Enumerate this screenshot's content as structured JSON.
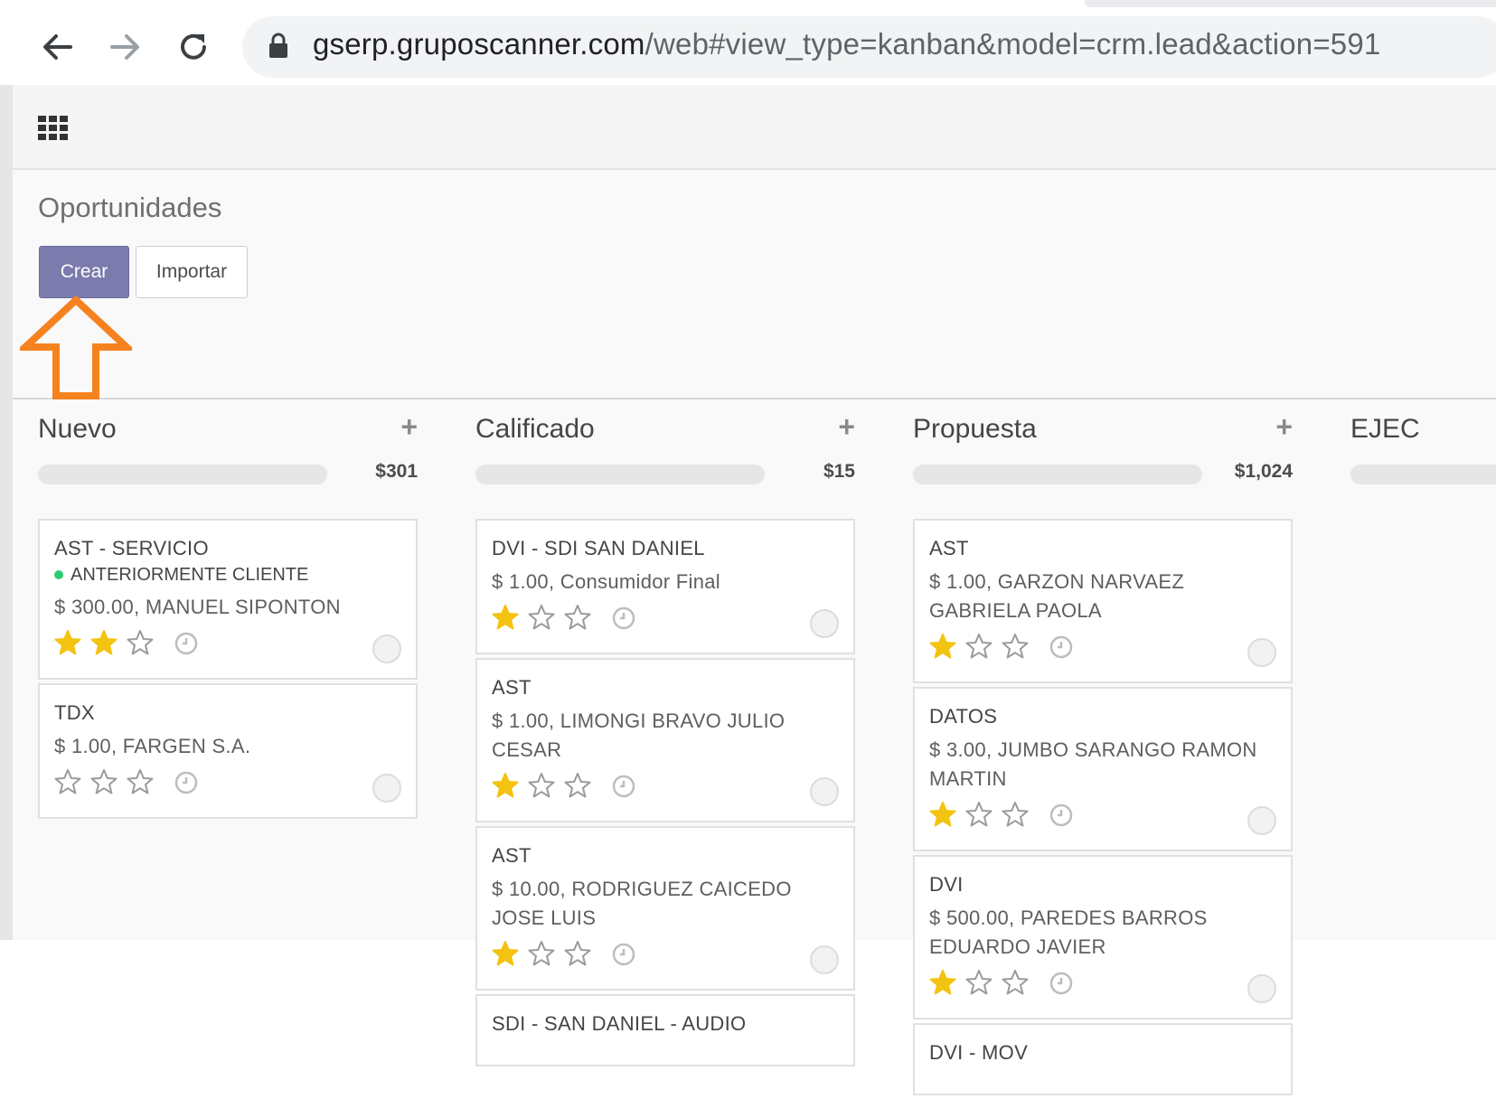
{
  "browser": {
    "url_host": "gserp.gruposcanner.com",
    "url_path": "/web#view_type=kanban&model=crm.lead&action=591",
    "back_icon": "arrow-left-icon",
    "forward_icon": "arrow-right-icon",
    "reload_icon": "reload-icon",
    "lock_icon": "lock-icon"
  },
  "control_panel": {
    "breadcrumb": "Oportunidades",
    "create_label": "Crear",
    "import_label": "Importar"
  },
  "colors": {
    "primary": "#7c7bad",
    "star": "#f3c311",
    "annotation": "#f5821f",
    "tag": "#2ecc71"
  },
  "columns": [
    {
      "title": "Nuevo",
      "total": "$301",
      "cards": [
        {
          "title": "AST - SERVICIO",
          "tag": "ANTERIORMENTE CLIENTE",
          "info": "$ 300.00, MANUEL SIPONTON",
          "stars": 2
        },
        {
          "title": "TDX",
          "info": "$ 1.00, FARGEN S.A.",
          "stars": 0
        }
      ]
    },
    {
      "title": "Calificado",
      "total": "$15",
      "cards": [
        {
          "title": "DVI - SDI SAN DANIEL",
          "info": "$ 1.00, Consumidor Final",
          "stars": 1
        },
        {
          "title": "AST",
          "info": "$ 1.00, LIMONGI BRAVO JULIO CESAR",
          "stars": 1
        },
        {
          "title": "AST",
          "info": "$ 10.00, RODRIGUEZ CAICEDO JOSE LUIS",
          "stars": 1
        },
        {
          "title": "SDI - SAN DANIEL - AUDIO"
        }
      ]
    },
    {
      "title": "Propuesta",
      "total": "$1,024",
      "cards": [
        {
          "title": "AST",
          "info": "$ 1.00, GARZON NARVAEZ GABRIELA PAOLA",
          "stars": 1
        },
        {
          "title": "DATOS",
          "info": "$ 3.00, JUMBO SARANGO RAMON MARTIN",
          "stars": 1
        },
        {
          "title": "DVI",
          "info": "$ 500.00, PAREDES BARROS EDUARDO JAVIER",
          "stars": 1
        },
        {
          "title": "DVI - MOV"
        }
      ]
    },
    {
      "title": "EJEC"
    }
  ]
}
